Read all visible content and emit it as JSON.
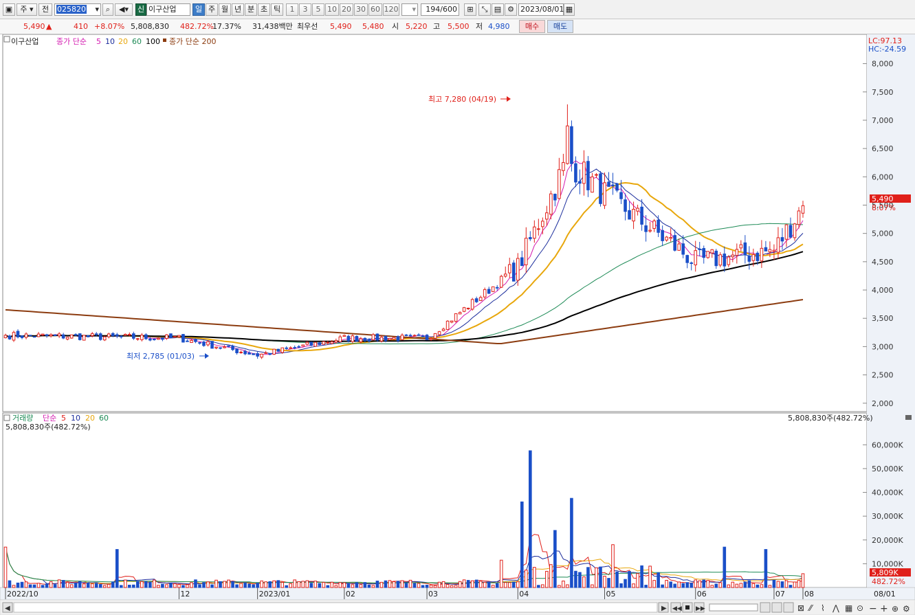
{
  "toolbar": {
    "window_icon": "window-icon",
    "period_type": "주",
    "reference": "전",
    "code": "025820",
    "stock_badge": "신",
    "stock_name": "이구산업",
    "periods": [
      "일",
      "주",
      "월",
      "년",
      "분",
      "초",
      "틱"
    ],
    "active_period": "일",
    "intervals": [
      "1",
      "3",
      "5",
      "10",
      "20",
      "30",
      "60",
      "120"
    ],
    "count": "194",
    "count_total": "/600",
    "date": "2023/08/01"
  },
  "quote": {
    "price": "5,490",
    "change": "410",
    "change_pct": "+8.07%",
    "volume": "5,808,830",
    "volume_ratio": "482.72%",
    "turnover": "17.37%",
    "amount": "31,438백만",
    "best_bid_label": "최우선",
    "best_ask": "5,490",
    "best_bid": "5,480",
    "open_label": "시",
    "open": "5,220",
    "high_label": "고",
    "high": "5,500",
    "low_label": "저",
    "low": "4,980",
    "buy_label": "매수",
    "sell_label": "매도"
  },
  "price_legend": {
    "name": "이구산업",
    "ma_label": "종가 단순",
    "ma_periods": [
      "5",
      "10",
      "20",
      "60",
      "100"
    ],
    "ma200_label": "종가 단순 200"
  },
  "price_panel": {
    "lc": "LC:97.13",
    "hc": "HC:-24.59",
    "last_price_tag": "5,490",
    "last_pct_tag": "8.07%",
    "high_annotation": "최고 7,280 (04/19)",
    "low_annotation": "최저 2,785 (01/03)",
    "y_ticks": [
      "8,000",
      "7,500",
      "7,000",
      "6,500",
      "6,000",
      "5,500",
      "5,000",
      "4,500",
      "4,000",
      "3,500",
      "3,000",
      "2,500",
      "2,000"
    ]
  },
  "volume_legend": {
    "name": "거래량",
    "ma_label": "단순",
    "ma_periods": [
      "5",
      "10",
      "20",
      "60"
    ],
    "sub_value": "5,808,830주(482.72%)",
    "right_value": "5,808,830주(482.72%)"
  },
  "volume_panel": {
    "y_ticks": [
      "60,000K",
      "50,000K",
      "40,000K",
      "30,000K",
      "20,000K",
      "10,000K"
    ],
    "last_vol_tag": "5,809K",
    "last_vol_pct": "482.72%"
  },
  "x_axis": {
    "labels": [
      "2022/10",
      "12",
      "2023/01",
      "02",
      "03",
      "04",
      "05",
      "06",
      "07",
      "08"
    ],
    "right_date": "08/01"
  },
  "colors": {
    "up": "#e0201a",
    "down": "#1a4fc8",
    "ma5": "#d41bb0",
    "ma10": "#1b2d9c",
    "ma20": "#e8a70c",
    "ma60": "#1c8a55",
    "ma100": "#000000",
    "ma200": "#8c3c10"
  },
  "chart_data": {
    "type": "candlestick",
    "description_scale": "y in KRW",
    "ylim": [
      1900,
      8250
    ],
    "highlights": {
      "high": 7280,
      "high_date": "04/19",
      "low": 2785,
      "low_date": "01/03"
    },
    "price_key_x": [
      "2022/10",
      "2022/12",
      "2023/01",
      "2023/02",
      "2023/03",
      "2023/04",
      "2023/04/19",
      "2023/05",
      "2023/06",
      "2023/07",
      "2023/08/01"
    ],
    "close_key": [
      3200,
      3150,
      2850,
      3150,
      3150,
      4400,
      6300,
      5700,
      4500,
      4700,
      5490
    ],
    "volume_unit": "K shares",
    "volume_ylim": [
      0,
      65000
    ],
    "volume_peaks": [
      {
        "x": "2022/10",
        "v": 17000
      },
      {
        "x": "2022/11",
        "v": 16000
      },
      {
        "x": "2023/03",
        "v": 11500
      },
      {
        "x": "2023/04",
        "v": 36000
      },
      {
        "x": "2023/04",
        "v": 57500
      },
      {
        "x": "2023/04",
        "v": 37500
      },
      {
        "x": "2023/04",
        "v": 24000
      },
      {
        "x": "2023/05",
        "v": 18000
      },
      {
        "x": "2023/07",
        "v": 17000
      },
      {
        "x": "2023/07",
        "v": 16000
      },
      {
        "x": "2023/08/01",
        "v": 5809
      }
    ]
  }
}
